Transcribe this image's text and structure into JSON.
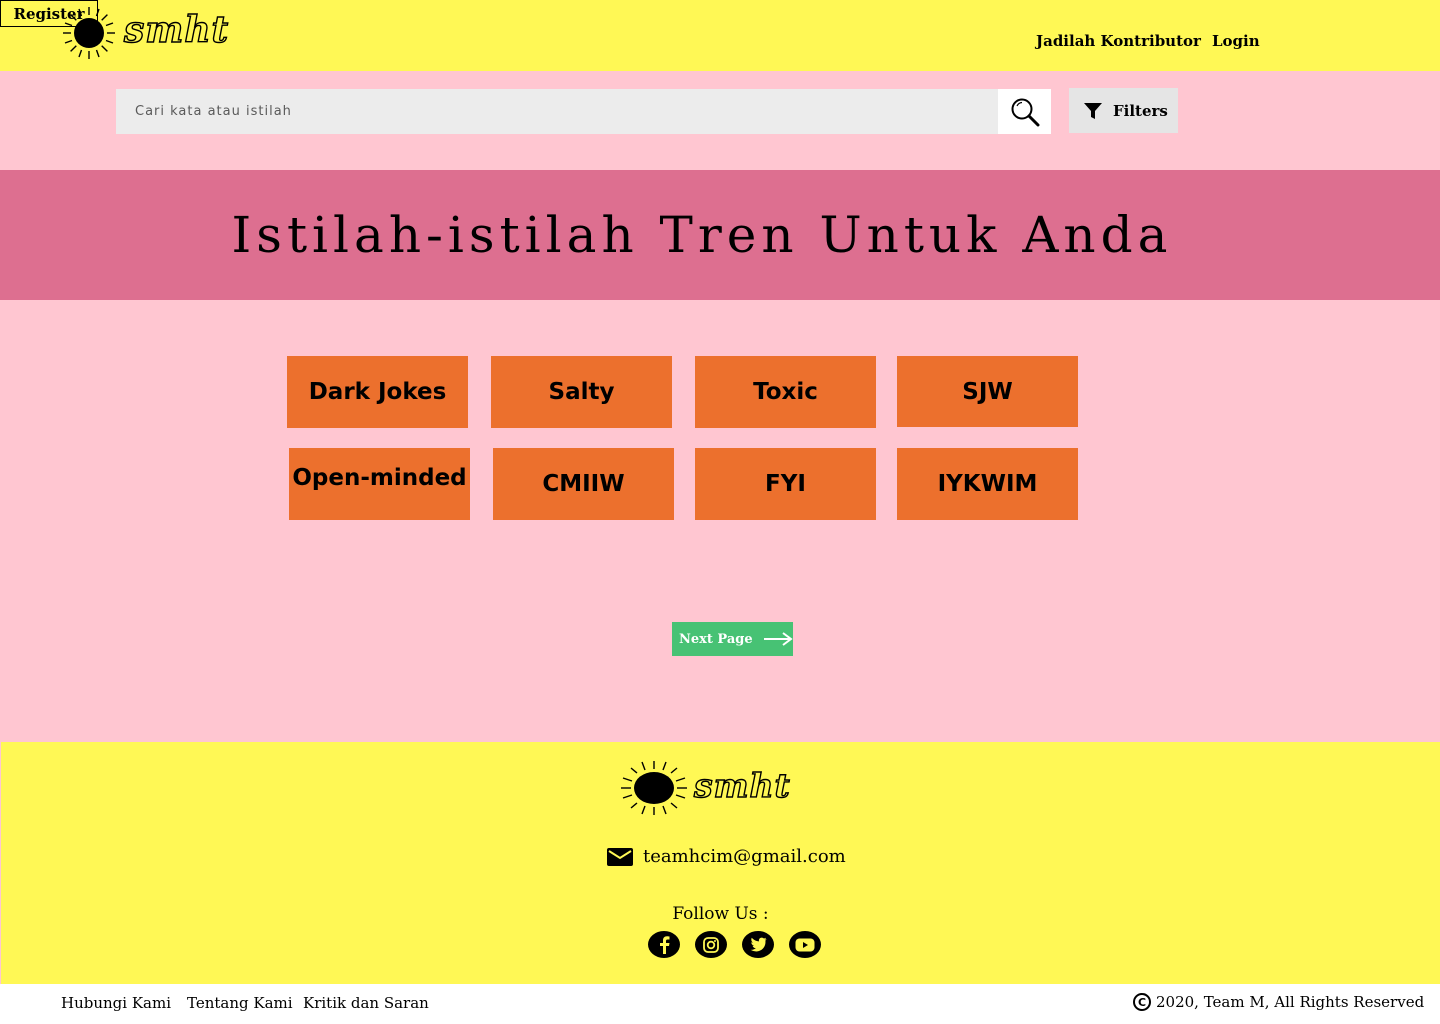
{
  "brand": {
    "name": "smht"
  },
  "nav": {
    "contributor": "Jadilah Kontributor",
    "login": "Login",
    "register": "Register"
  },
  "search": {
    "placeholder": "Cari kata atau istilah",
    "value": "",
    "icon": "search-icon"
  },
  "filters": {
    "label": "Filters",
    "icon": "filter-icon"
  },
  "banner": {
    "title": "Istilah-istilah Tren Untuk Anda"
  },
  "terms": [
    "Dark Jokes",
    "Salty",
    "Toxic",
    "SJW",
    "Open-minded",
    "CMIIW",
    "FYI",
    "IYKWIM"
  ],
  "pagination": {
    "next_label": "Next Page",
    "icon": "arrow-right-icon"
  },
  "footer": {
    "email": "teamhcim@gmail.com",
    "follow_label": "Follow Us :",
    "socials": [
      "facebook-icon",
      "instagram-icon",
      "twitter-icon",
      "youtube-icon"
    ]
  },
  "bottom": {
    "links": [
      "Hubungi Kami",
      "Tentang Kami",
      "Kritik dan Saran"
    ],
    "copyright": "2020, Team M, All Rights Reserved"
  },
  "colors": {
    "header": "#fff855",
    "page_bg": "#ffc6d1",
    "banner": "#dd6f90",
    "term_button": "#ec702d",
    "next_button": "#47c274"
  }
}
